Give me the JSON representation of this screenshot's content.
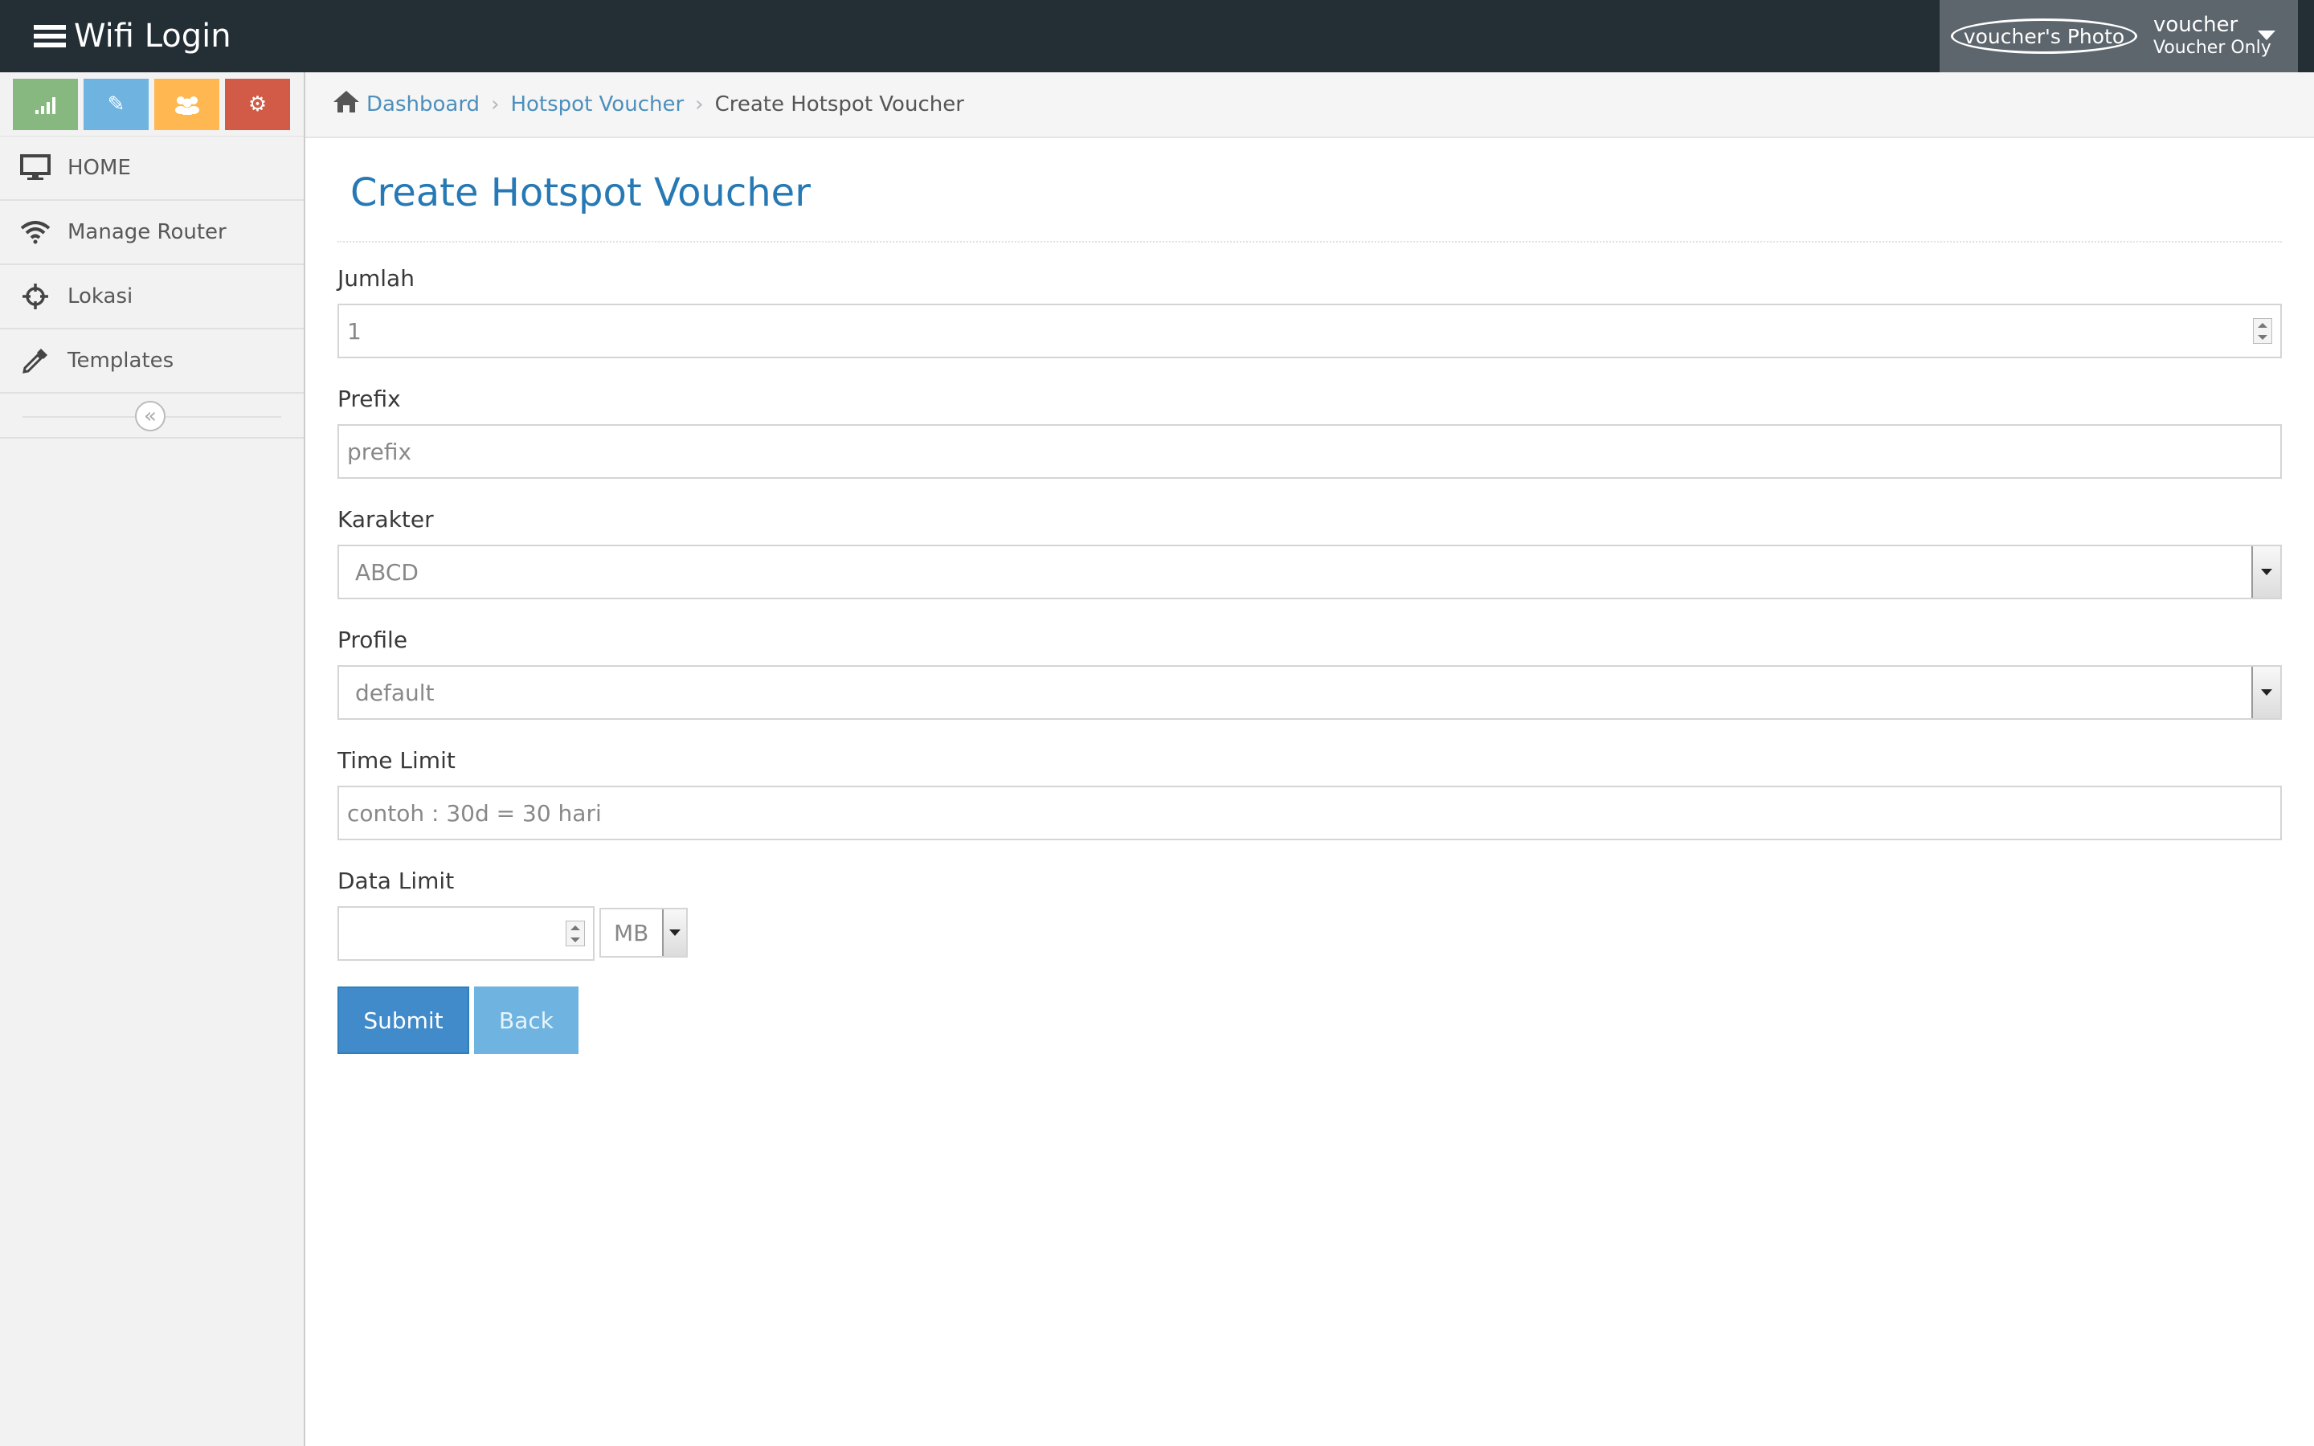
{
  "navbar": {
    "brand": "Wifi Login",
    "user": {
      "photo_alt": "voucher's Photo",
      "name": "voucher",
      "role": "Voucher Only"
    }
  },
  "sidebar": {
    "shortcuts": [
      {
        "icon": "signal-icon",
        "color": "#87b87f"
      },
      {
        "icon": "pencil-icon",
        "color": "#6fb3e0"
      },
      {
        "icon": "users-icon",
        "color": "#ffb752"
      },
      {
        "icon": "cogs-icon",
        "color": "#d15b47"
      }
    ],
    "items": [
      {
        "label": "HOME",
        "icon": "desktop-icon"
      },
      {
        "label": "Manage Router",
        "icon": "wifi-icon"
      },
      {
        "label": "Lokasi",
        "icon": "crosshairs-icon"
      },
      {
        "label": "Templates",
        "icon": "eyedropper-icon"
      }
    ]
  },
  "breadcrumb": {
    "items": [
      "Dashboard",
      "Hotspot Voucher"
    ],
    "active": "Create Hotspot Voucher"
  },
  "page": {
    "title": "Create Hotspot Voucher"
  },
  "form": {
    "jumlah": {
      "label": "Jumlah",
      "value": "1"
    },
    "prefix": {
      "label": "Prefix",
      "placeholder": "prefix"
    },
    "karakter": {
      "label": "Karakter",
      "selected": "ABCD"
    },
    "profile": {
      "label": "Profile",
      "selected": "default"
    },
    "time_limit": {
      "label": "Time Limit",
      "placeholder": "contoh : 30d = 30 hari"
    },
    "data_limit": {
      "label": "Data Limit",
      "value": "",
      "unit": "MB"
    },
    "submit_label": "Submit",
    "back_label": "Back"
  },
  "colors": {
    "navbar": "#242e35",
    "accent": "#2679b5",
    "link": "#4c8fbd",
    "submit": "#428bca",
    "back": "#6fb3e0"
  }
}
